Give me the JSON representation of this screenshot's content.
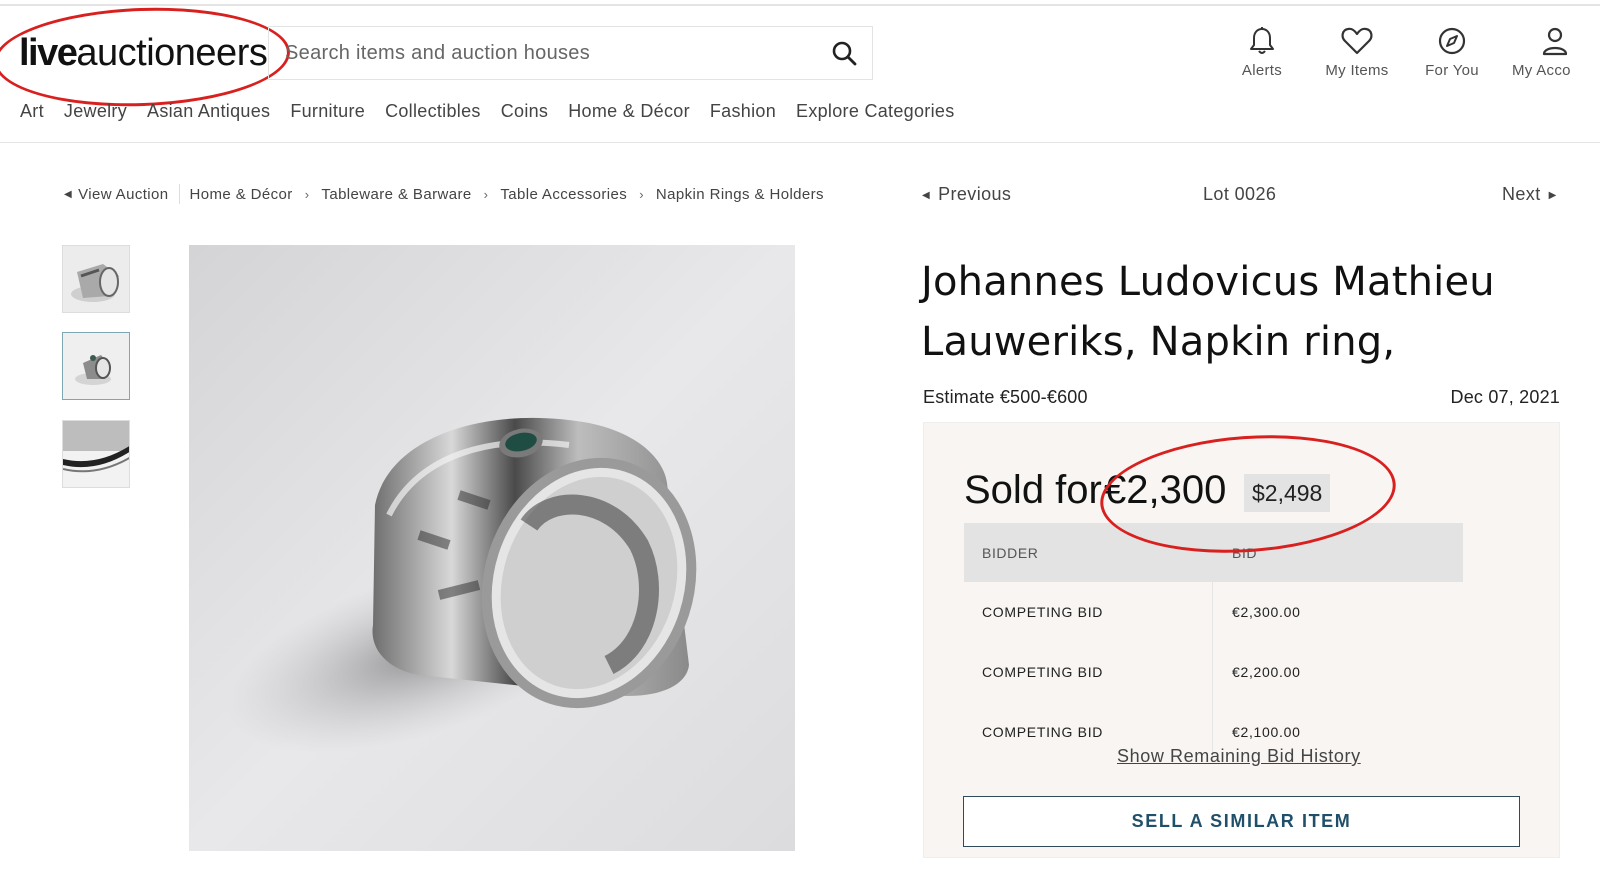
{
  "header": {
    "logo": {
      "bold": "live",
      "light": "auctioneers"
    },
    "search": {
      "placeholder": "Search items and auction houses"
    },
    "icons": [
      {
        "name": "alerts",
        "label": "Alerts"
      },
      {
        "name": "my-items",
        "label": "My Items"
      },
      {
        "name": "for-you",
        "label": "For You"
      },
      {
        "name": "my-account",
        "label": "My Acco"
      }
    ],
    "categories": [
      "Art",
      "Jewelry",
      "Asian Antiques",
      "Furniture",
      "Collectibles",
      "Coins",
      "Home & Décor",
      "Fashion",
      "Explore Categories"
    ]
  },
  "breadcrumb": {
    "back": "View Auction",
    "items": [
      "Home & Décor",
      "Tableware & Barware",
      "Table Accessories",
      "Napkin Rings & Holders"
    ]
  },
  "lot_nav": {
    "previous": "Previous",
    "lot": "Lot 0026",
    "next": "Next"
  },
  "lot": {
    "title": "Johannes Ludovicus Mathieu Lauweriks, Napkin ring,",
    "estimate": "Estimate €500-€600",
    "date": "Dec 07, 2021",
    "sold_label": "Sold for",
    "sold_price": "€2,300",
    "sold_usd": "$2,498"
  },
  "bid_history": {
    "columns": [
      "BIDDER",
      "BID"
    ],
    "rows": [
      {
        "bidder": "COMPETING BID",
        "bid": "€2,300.00"
      },
      {
        "bidder": "COMPETING BID",
        "bid": "€2,200.00"
      },
      {
        "bidder": "COMPETING BID",
        "bid": "€2,100.00"
      }
    ],
    "show_more": "Show Remaining Bid History"
  },
  "actions": {
    "sell_similar": "SELL A SIMILAR ITEM"
  },
  "colors": {
    "annotation_red": "#d8201f",
    "button_text": "#1f4f6a",
    "panel_bg": "#f8f5f2"
  }
}
